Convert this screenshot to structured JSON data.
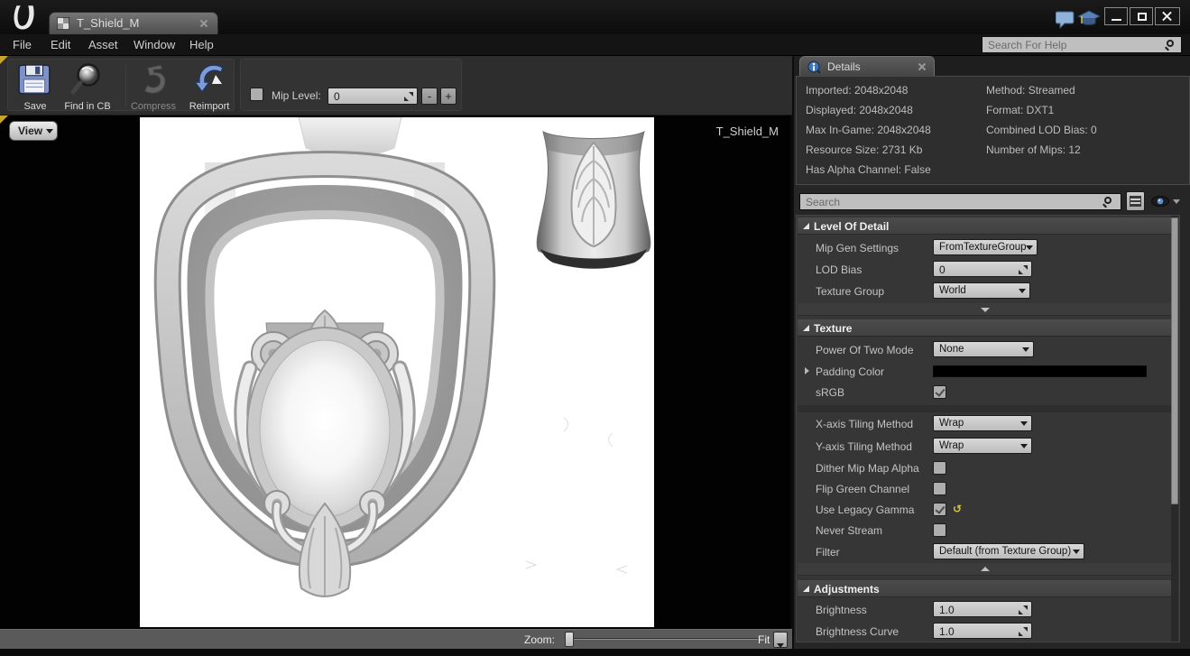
{
  "window": {
    "tab_title": "T_Shield_M",
    "menu_items": [
      "File",
      "Edit",
      "Asset",
      "Window",
      "Help"
    ],
    "help_search_placeholder": "Search For Help"
  },
  "toolbar": {
    "buttons": [
      {
        "label": "Save",
        "enabled": true
      },
      {
        "label": "Find in CB",
        "enabled": true
      },
      {
        "label": "Compress",
        "enabled": false
      },
      {
        "label": "Reimport",
        "enabled": true
      }
    ],
    "mip_level": {
      "label": "Mip Level:",
      "value": "0",
      "checkbox_checked": false
    }
  },
  "viewport": {
    "view_button_label": "View",
    "texture_name_overlay": "T_Shield_M",
    "zoom_label": "Zoom:",
    "fit_label": "Fit",
    "zoom_slider_position_pct": 0
  },
  "details": {
    "tab_title": "Details",
    "info_left": [
      "Imported: 2048x2048",
      "Displayed: 2048x2048",
      "Max In-Game: 2048x2048",
      "Resource Size: 2731 Kb",
      "Has Alpha Channel: False"
    ],
    "info_right": [
      "Method: Streamed",
      "Format: DXT1",
      "Combined LOD Bias: 0",
      "Number of Mips: 12"
    ],
    "search_placeholder": "Search",
    "sections": [
      {
        "title": "Level Of Detail",
        "rows": [
          {
            "label": "Mip Gen Settings",
            "control": "dropdown",
            "value": "FromTextureGroup"
          },
          {
            "label": "LOD Bias",
            "control": "spinner",
            "value": "0"
          },
          {
            "label": "Texture Group",
            "control": "dropdown",
            "value": "World"
          }
        ]
      },
      {
        "title": "Texture",
        "rows": [
          {
            "label": "Power Of Two Mode",
            "control": "dropdown",
            "value": "None"
          },
          {
            "label": "Padding Color",
            "control": "color",
            "value": "#000000",
            "expandable": true
          },
          {
            "label": "sRGB",
            "control": "checkbox",
            "checked": true
          },
          {
            "label": "X-axis Tiling Method",
            "control": "dropdown",
            "value": "Wrap"
          },
          {
            "label": "Y-axis Tiling Method",
            "control": "dropdown",
            "value": "Wrap"
          },
          {
            "label": "Dither Mip Map Alpha",
            "control": "checkbox",
            "checked": false
          },
          {
            "label": "Flip Green Channel",
            "control": "checkbox",
            "checked": false
          },
          {
            "label": "Use Legacy Gamma",
            "control": "checkbox",
            "checked": true,
            "has_reset": true
          },
          {
            "label": "Never Stream",
            "control": "checkbox",
            "checked": false
          },
          {
            "label": "Filter",
            "control": "dropdown",
            "value": "Default (from Texture Group)"
          }
        ]
      },
      {
        "title": "Adjustments",
        "rows": [
          {
            "label": "Brightness",
            "control": "spinner",
            "value": "1.0"
          },
          {
            "label": "Brightness Curve",
            "control": "spinner",
            "value": "1.0"
          }
        ]
      }
    ]
  },
  "icons": {
    "reset_to_default": "↺",
    "minus": "-",
    "plus": "+"
  },
  "colors": {
    "accent_blue": "#3f74b8",
    "reset_yellow": "#d9c84a",
    "padding_color_value": "#000000",
    "corner_flag": "#c8a42a",
    "viewport_bg": "#000000"
  }
}
